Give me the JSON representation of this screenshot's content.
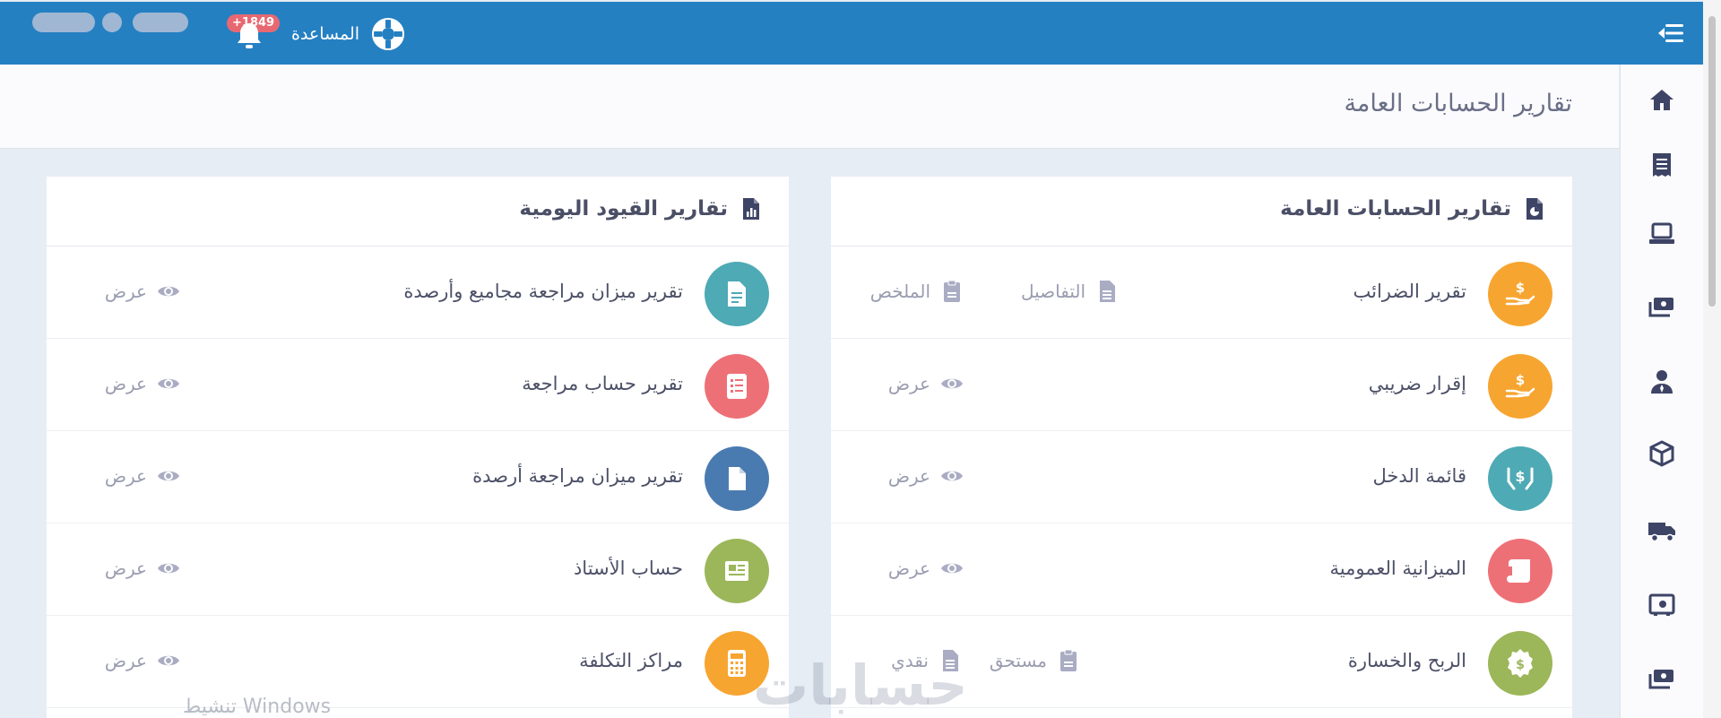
{
  "header": {
    "help_label": "المساعدة",
    "notifications_count": "+1849"
  },
  "page": {
    "title": "تقارير الحسابات العامة"
  },
  "colors": {
    "topbar": "#2580c2",
    "orange": "#f7a531",
    "teal": "#4eaab4",
    "red": "#ee7077",
    "green": "#9cb65a",
    "blue": "#4a7bb0"
  },
  "cards": {
    "general": {
      "title": "تقارير الحسابات العامة",
      "icon": "pie-file-icon",
      "rows": [
        {
          "label": "تقرير الضرائب",
          "icon": "hand-dollar-icon",
          "actions": [
            "التفاصيل",
            "الملخص"
          ]
        },
        {
          "label": "إقرار ضريبي",
          "icon": "hand-dollar-icon",
          "actions": [
            "عرض"
          ]
        },
        {
          "label": "قائمة الدخل",
          "icon": "hands-dollar-icon",
          "actions": [
            "عرض"
          ]
        },
        {
          "label": "الميزانية العمومية",
          "icon": "scroll-icon",
          "actions": [
            "عرض"
          ]
        },
        {
          "label": "الربح والخسارة",
          "icon": "dollar-badge-icon",
          "actions": [
            "مستحق",
            "نقدي"
          ]
        }
      ]
    },
    "journal": {
      "title": "تقارير القيود اليومية",
      "icon": "chart-file-icon",
      "rows": [
        {
          "label": "تقرير ميزان مراجعة مجاميع وأرصدة",
          "icon": "document-icon",
          "actions": [
            "عرض"
          ]
        },
        {
          "label": "تقرير حساب مراجعة",
          "icon": "checklist-icon",
          "actions": [
            "عرض"
          ]
        },
        {
          "label": "تقرير ميزان مراجعة أرصدة",
          "icon": "file-icon",
          "actions": [
            "عرض"
          ]
        },
        {
          "label": "حساب الأستاذ",
          "icon": "newspaper-icon",
          "actions": [
            "عرض"
          ]
        },
        {
          "label": "مراكز التكلفة",
          "icon": "calculator-icon",
          "actions": [
            "عرض"
          ]
        }
      ]
    }
  },
  "overlay": {
    "watermark": "حسابات",
    "windows_text": "تنشيط Windows"
  }
}
